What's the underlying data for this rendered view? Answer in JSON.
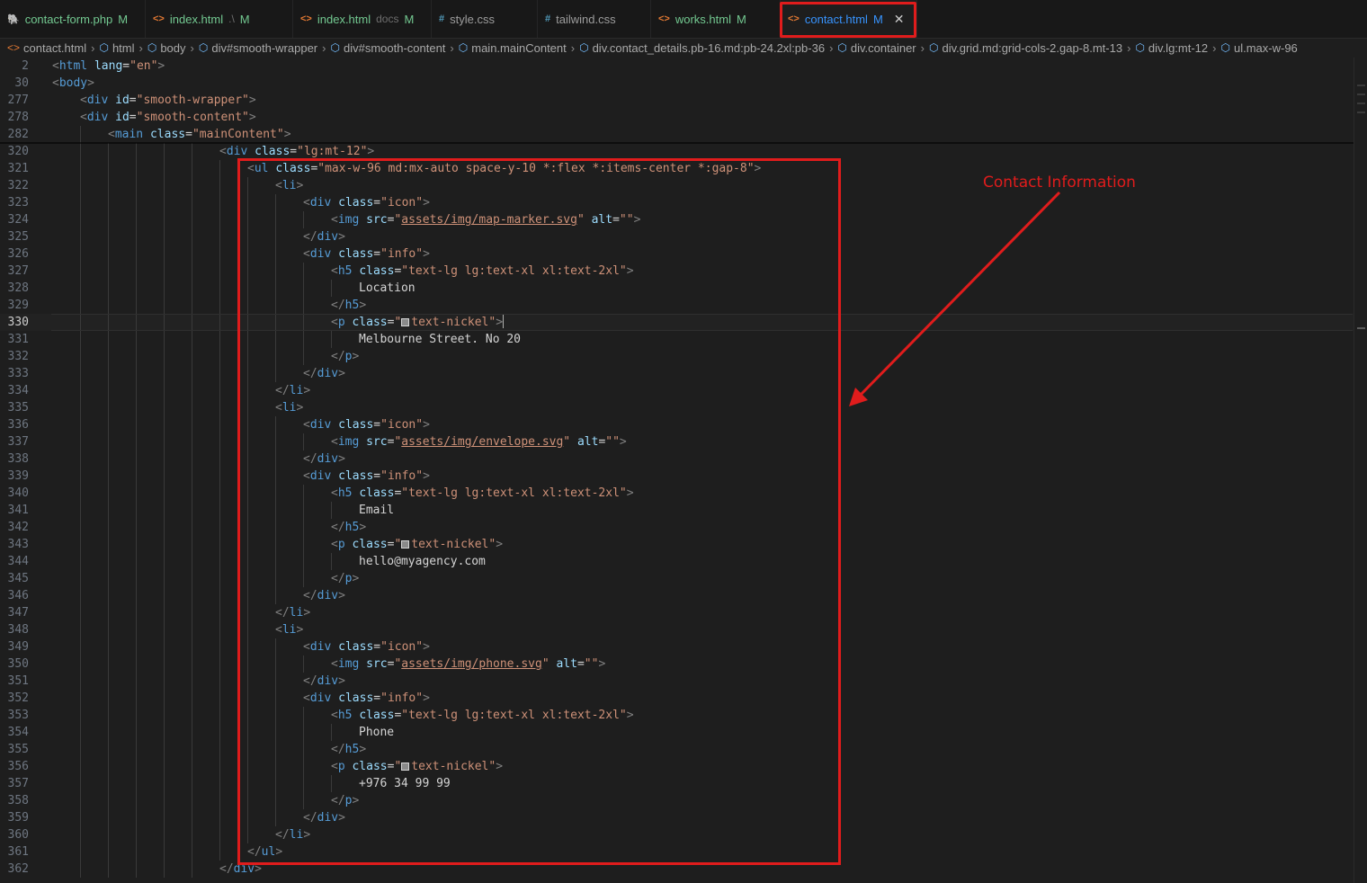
{
  "tabs": [
    {
      "icon": "php-icon",
      "glyph": "🐘",
      "name": "contact-form.php",
      "dir": "",
      "status": "M",
      "git": true,
      "active": false,
      "w": 162
    },
    {
      "icon": "html-icon",
      "glyph": "<>",
      "name": "index.html",
      "dir": ".\\",
      "status": "M",
      "git": true,
      "active": false,
      "w": 164
    },
    {
      "icon": "html-icon",
      "glyph": "<>",
      "name": "index.html",
      "dir": "docs",
      "status": "M",
      "git": true,
      "active": false,
      "w": 154
    },
    {
      "icon": "css-icon",
      "glyph": "#",
      "name": "style.css",
      "dir": "",
      "status": "",
      "git": false,
      "active": false,
      "w": 118
    },
    {
      "icon": "css-icon",
      "glyph": "#",
      "name": "tailwind.css",
      "dir": "",
      "status": "",
      "git": false,
      "active": false,
      "w": 126
    },
    {
      "icon": "html-icon",
      "glyph": "<>",
      "name": "works.html",
      "dir": "",
      "status": "M",
      "git": true,
      "active": false,
      "w": 144
    },
    {
      "icon": "html-icon",
      "glyph": "<>",
      "name": "contact.html",
      "dir": "",
      "status": "M",
      "git": true,
      "active": true,
      "w": 152
    }
  ],
  "colors": {
    "html_icon": "#e37933",
    "css_icon": "#519aba",
    "php_icon": "#a074c4",
    "git_modified": "#73c991",
    "active_tab": "#3794ff",
    "annotation": "#e01c1c"
  },
  "breadcrumbs": [
    {
      "label": "contact.html",
      "icon": "html-icon"
    },
    {
      "label": "html",
      "icon": "element-icon"
    },
    {
      "label": "body",
      "icon": "element-icon"
    },
    {
      "label": "div#smooth-wrapper",
      "icon": "element-icon"
    },
    {
      "label": "div#smooth-content",
      "icon": "element-icon"
    },
    {
      "label": "main.mainContent",
      "icon": "element-icon"
    },
    {
      "label": "div.contact_details.pb-16.md:pb-24.2xl:pb-36",
      "icon": "element-icon"
    },
    {
      "label": "div.container",
      "icon": "element-icon"
    },
    {
      "label": "div.grid.md:grid-cols-2.gap-8.mt-13",
      "icon": "element-icon"
    },
    {
      "label": "div.lg:mt-12",
      "icon": "element-icon"
    },
    {
      "label": "ul.max-w-96",
      "icon": "element-icon"
    }
  ],
  "lines": [
    {
      "n": "2",
      "i": 0,
      "k": "open",
      "tag": "html",
      "attrs": [
        [
          "lang",
          "en"
        ]
      ]
    },
    {
      "n": "30",
      "i": 0,
      "k": "open",
      "tag": "body",
      "attrs": []
    },
    {
      "n": "277",
      "i": 1,
      "k": "open",
      "tag": "div",
      "attrs": [
        [
          "id",
          "smooth-wrapper"
        ]
      ]
    },
    {
      "n": "278",
      "i": 1,
      "k": "open",
      "tag": "div",
      "attrs": [
        [
          "id",
          "smooth-content"
        ]
      ]
    },
    {
      "n": "282",
      "i": 2,
      "k": "open",
      "tag": "main",
      "attrs": [
        [
          "class",
          "mainContent"
        ]
      ]
    },
    {
      "n": "320",
      "i": 6,
      "k": "open",
      "tag": "div",
      "attrs": [
        [
          "class",
          "lg:mt-12"
        ]
      ]
    },
    {
      "n": "321",
      "i": 7,
      "k": "open",
      "tag": "ul",
      "attrs": [
        [
          "class",
          "max-w-96 md:mx-auto space-y-10 *:flex *:items-center *:gap-8"
        ]
      ]
    },
    {
      "n": "322",
      "i": 8,
      "k": "open",
      "tag": "li",
      "attrs": []
    },
    {
      "n": "323",
      "i": 9,
      "k": "open",
      "tag": "div",
      "attrs": [
        [
          "class",
          "icon"
        ]
      ]
    },
    {
      "n": "324",
      "i": 10,
      "k": "img",
      "tag": "img",
      "attrs": [
        [
          "src",
          "assets/img/map-marker.svg"
        ],
        [
          "alt",
          ""
        ]
      ]
    },
    {
      "n": "325",
      "i": 9,
      "k": "close",
      "tag": "div"
    },
    {
      "n": "326",
      "i": 9,
      "k": "open",
      "tag": "div",
      "attrs": [
        [
          "class",
          "info"
        ]
      ]
    },
    {
      "n": "327",
      "i": 10,
      "k": "open",
      "tag": "h5",
      "attrs": [
        [
          "class",
          "text-lg lg:text-xl xl:text-2xl"
        ]
      ]
    },
    {
      "n": "328",
      "i": 11,
      "k": "text",
      "text": "Location"
    },
    {
      "n": "329",
      "i": 10,
      "k": "close",
      "tag": "h5"
    },
    {
      "n": "330",
      "i": 10,
      "k": "open",
      "tag": "p",
      "attrs": [
        [
          "class",
          "text-nickel"
        ]
      ],
      "swatch": true,
      "current": true
    },
    {
      "n": "331",
      "i": 11,
      "k": "text",
      "text": "Melbourne Street. No 20"
    },
    {
      "n": "332",
      "i": 10,
      "k": "close",
      "tag": "p"
    },
    {
      "n": "333",
      "i": 9,
      "k": "close",
      "tag": "div"
    },
    {
      "n": "334",
      "i": 8,
      "k": "close",
      "tag": "li"
    },
    {
      "n": "335",
      "i": 8,
      "k": "open",
      "tag": "li",
      "attrs": []
    },
    {
      "n": "336",
      "i": 9,
      "k": "open",
      "tag": "div",
      "attrs": [
        [
          "class",
          "icon"
        ]
      ]
    },
    {
      "n": "337",
      "i": 10,
      "k": "img",
      "tag": "img",
      "attrs": [
        [
          "src",
          "assets/img/envelope.svg"
        ],
        [
          "alt",
          ""
        ]
      ]
    },
    {
      "n": "338",
      "i": 9,
      "k": "close",
      "tag": "div"
    },
    {
      "n": "339",
      "i": 9,
      "k": "open",
      "tag": "div",
      "attrs": [
        [
          "class",
          "info"
        ]
      ]
    },
    {
      "n": "340",
      "i": 10,
      "k": "open",
      "tag": "h5",
      "attrs": [
        [
          "class",
          "text-lg lg:text-xl xl:text-2xl"
        ]
      ]
    },
    {
      "n": "341",
      "i": 11,
      "k": "text",
      "text": "Email"
    },
    {
      "n": "342",
      "i": 10,
      "k": "close",
      "tag": "h5"
    },
    {
      "n": "343",
      "i": 10,
      "k": "open",
      "tag": "p",
      "attrs": [
        [
          "class",
          "text-nickel"
        ]
      ],
      "swatch": true
    },
    {
      "n": "344",
      "i": 11,
      "k": "text",
      "text": "hello@myagency.com"
    },
    {
      "n": "345",
      "i": 10,
      "k": "close",
      "tag": "p"
    },
    {
      "n": "346",
      "i": 9,
      "k": "close",
      "tag": "div"
    },
    {
      "n": "347",
      "i": 8,
      "k": "close",
      "tag": "li"
    },
    {
      "n": "348",
      "i": 8,
      "k": "open",
      "tag": "li",
      "attrs": []
    },
    {
      "n": "349",
      "i": 9,
      "k": "open",
      "tag": "div",
      "attrs": [
        [
          "class",
          "icon"
        ]
      ]
    },
    {
      "n": "350",
      "i": 10,
      "k": "img",
      "tag": "img",
      "attrs": [
        [
          "src",
          "assets/img/phone.svg"
        ],
        [
          "alt",
          ""
        ]
      ]
    },
    {
      "n": "351",
      "i": 9,
      "k": "close",
      "tag": "div"
    },
    {
      "n": "352",
      "i": 9,
      "k": "open",
      "tag": "div",
      "attrs": [
        [
          "class",
          "info"
        ]
      ]
    },
    {
      "n": "353",
      "i": 10,
      "k": "open",
      "tag": "h5",
      "attrs": [
        [
          "class",
          "text-lg lg:text-xl xl:text-2xl"
        ]
      ]
    },
    {
      "n": "354",
      "i": 11,
      "k": "text",
      "text": "Phone"
    },
    {
      "n": "355",
      "i": 10,
      "k": "close",
      "tag": "h5"
    },
    {
      "n": "356",
      "i": 10,
      "k": "open",
      "tag": "p",
      "attrs": [
        [
          "class",
          "text-nickel"
        ]
      ],
      "swatch": true
    },
    {
      "n": "357",
      "i": 11,
      "k": "text",
      "text": "+976 34 99 99"
    },
    {
      "n": "358",
      "i": 10,
      "k": "close",
      "tag": "p"
    },
    {
      "n": "359",
      "i": 9,
      "k": "close",
      "tag": "div"
    },
    {
      "n": "360",
      "i": 8,
      "k": "close",
      "tag": "li"
    },
    {
      "n": "361",
      "i": 7,
      "k": "close",
      "tag": "ul"
    },
    {
      "n": "362",
      "i": 6,
      "k": "close",
      "tag": "div"
    }
  ],
  "annotation": {
    "label": "Contact Information"
  }
}
